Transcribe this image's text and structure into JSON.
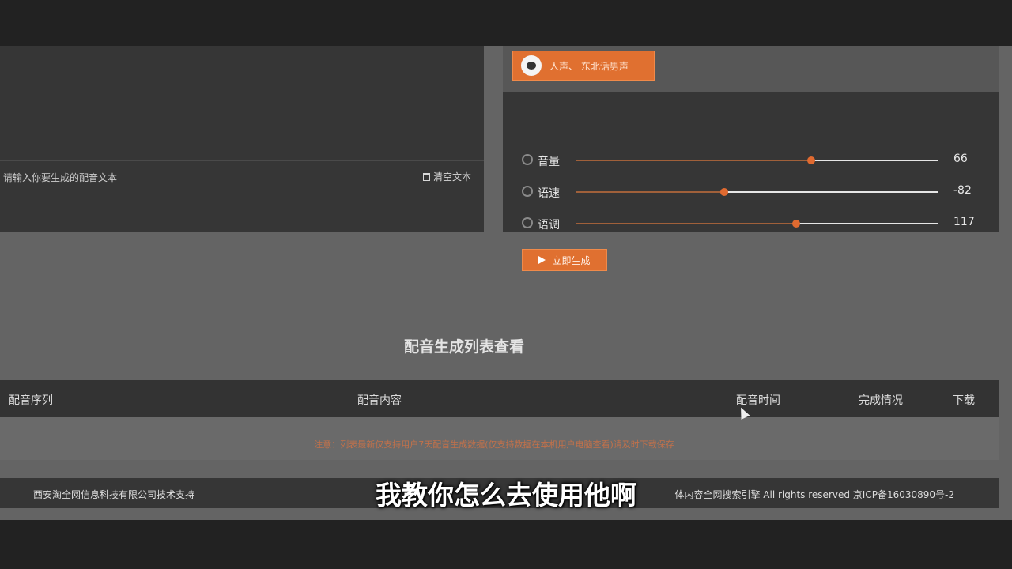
{
  "editor": {
    "placeholder": "请输入你要生成的配音文本",
    "clear_label": "清空文本"
  },
  "voice": {
    "label": "人声、 东北话男声"
  },
  "sliders": [
    {
      "label": "音量",
      "value": "66",
      "level": 0.65,
      "icon": "speaker-icon"
    },
    {
      "label": "语速",
      "value": "-82",
      "level": 0.41,
      "icon": "speed-icon"
    },
    {
      "label": "语调",
      "value": "117",
      "level": 0.61,
      "icon": "tone-icon"
    }
  ],
  "generate_label": "立即生成",
  "section": {
    "title": "配音生成列表查看"
  },
  "table": {
    "headers": [
      "配音序列",
      "配音内容",
      "配音时间",
      "完成情况",
      "下载"
    ],
    "notice": "注意：列表最新仅支持用户7天配音生成数据(仅支持数据在本机用户电脑查看)请及时下载保存"
  },
  "footer": {
    "left": "西安淘全网信息科技有限公司技术支持",
    "right": "体内容全网搜索引擎 All rights reserved 京ICP备16030890号-2"
  },
  "subtitle": "我教你怎么去使用他啊",
  "colors": {
    "accent": "#e07030",
    "panel": "#363636",
    "background": "#646464"
  }
}
